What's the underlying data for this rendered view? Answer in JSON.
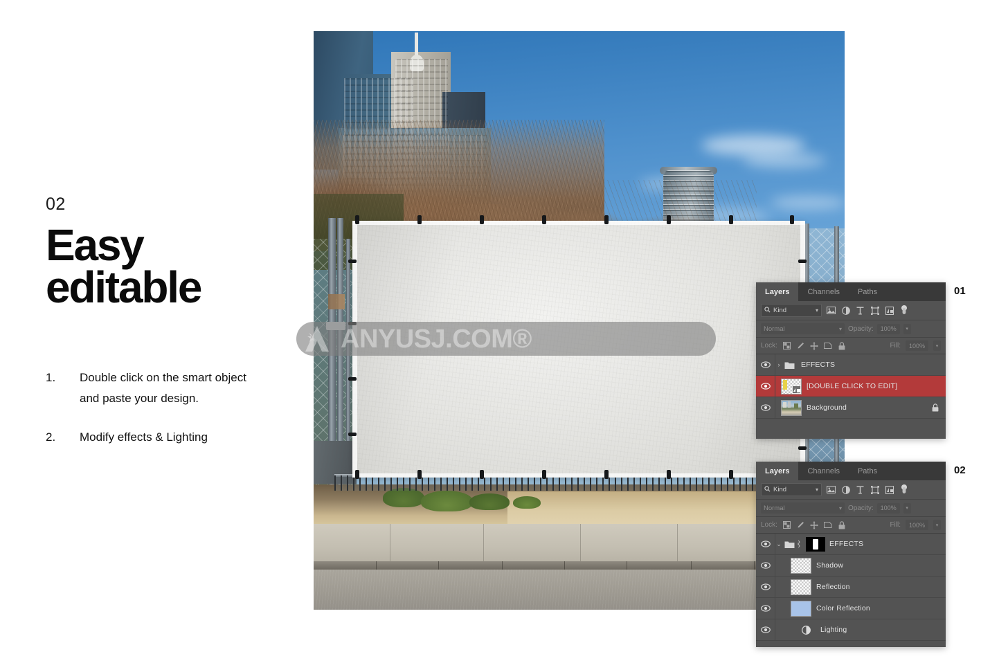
{
  "left_panel": {
    "step_number": "02",
    "headline_line1": "Easy",
    "headline_line2": "editable",
    "instructions": [
      {
        "index": "1.",
        "text": "Double click on the smart object and paste your design."
      },
      {
        "index": "2.",
        "text": "Modify effects & Lighting"
      }
    ]
  },
  "watermark": {
    "text": "ANYUSJ.COM®",
    "logo_name": "anyusj-logo-icon",
    "color": "#808080"
  },
  "photo": {
    "alt": "city-billboard-mockup-photo",
    "banner_label": "blank-white-banner"
  },
  "panels": [
    {
      "label": "01",
      "tabs": [
        {
          "name": "Layers",
          "active": true
        },
        {
          "name": "Channels",
          "active": false
        },
        {
          "name": "Paths",
          "active": false
        }
      ],
      "filter": {
        "kind_label": "Kind",
        "search_icon": "search-icon",
        "chevron": "⌄",
        "icons": [
          "pixel-filter-icon",
          "adjustment-filter-icon",
          "type-filter-icon",
          "shape-filter-icon",
          "smart-object-filter-icon",
          "filter-toggle-icon"
        ]
      },
      "blend": {
        "mode": "Normal",
        "opacity_label": "Opacity:",
        "opacity_value": "100%"
      },
      "lock": {
        "label": "Lock:",
        "icons": [
          "lock-transparency-icon",
          "lock-image-icon",
          "lock-position-icon",
          "lock-nesting-icon",
          "lock-all-icon"
        ],
        "fill_label": "Fill:",
        "fill_value": "100%"
      },
      "layers": [
        {
          "name": "EFFECTS",
          "type": "group",
          "visible": true,
          "expanded": false,
          "selected": false,
          "locked": false
        },
        {
          "name": "[DOUBLE CLICK TO EDIT]",
          "type": "smart-object",
          "visible": true,
          "selected": true,
          "locked": false
        },
        {
          "name": "Background",
          "type": "image",
          "visible": true,
          "selected": false,
          "locked": true
        }
      ]
    },
    {
      "label": "02",
      "tabs": [
        {
          "name": "Layers",
          "active": true
        },
        {
          "name": "Channels",
          "active": false
        },
        {
          "name": "Paths",
          "active": false
        }
      ],
      "filter": {
        "kind_label": "Kind",
        "search_icon": "search-icon",
        "chevron": "⌄",
        "icons": [
          "pixel-filter-icon",
          "adjustment-filter-icon",
          "type-filter-icon",
          "shape-filter-icon",
          "smart-object-filter-icon",
          "filter-toggle-icon"
        ]
      },
      "blend": {
        "mode": "Normal",
        "opacity_label": "Opacity:",
        "opacity_value": "100%"
      },
      "lock": {
        "label": "Lock:",
        "icons": [
          "lock-transparency-icon",
          "lock-image-icon",
          "lock-position-icon",
          "lock-nesting-icon",
          "lock-all-icon"
        ],
        "fill_label": "Fill:",
        "fill_value": "100%"
      },
      "layers": [
        {
          "name": "EFFECTS",
          "type": "group-masked",
          "visible": true,
          "expanded": true,
          "selected": false,
          "locked": false
        },
        {
          "name": "Shadow",
          "type": "transparent",
          "visible": true,
          "selected": false,
          "locked": false
        },
        {
          "name": "Reflection",
          "type": "transparent",
          "visible": true,
          "selected": false,
          "locked": false
        },
        {
          "name": "Color Reflection",
          "type": "solid",
          "color": "#a8c3e8",
          "visible": true,
          "selected": false,
          "locked": false
        },
        {
          "name": "Lighting",
          "type": "adjustment",
          "visible": true,
          "selected": false,
          "locked": false
        }
      ]
    }
  ]
}
